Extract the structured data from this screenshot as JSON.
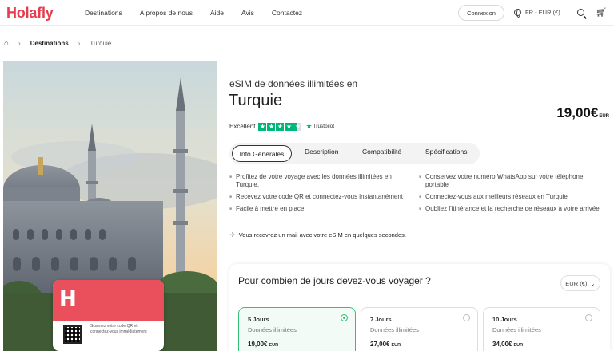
{
  "header": {
    "logo": "Holafly",
    "nav": [
      "Destinations",
      "A propos de nous",
      "Aide",
      "Avis",
      "Contactez"
    ],
    "login_label": "Connexion",
    "locale": "FR - EUR (€)"
  },
  "breadcrumb": {
    "destinations": "Destinations",
    "current": "Turquie"
  },
  "sim_card": {
    "logo": "H",
    "text": "Scannez votre code QR et connectez-vous immédiatement"
  },
  "product": {
    "subtitle": "eSIM de données illimitées en",
    "title": "Turquie",
    "price": "19,00€",
    "price_currency": "EUR",
    "rating_label": "Excellent",
    "trustpilot": "Trustpilot",
    "rating_stars": 4.5
  },
  "tabs": [
    {
      "label": "Info Générales",
      "active": true
    },
    {
      "label": "Description",
      "active": false
    },
    {
      "label": "Compatibilité",
      "active": false
    },
    {
      "label": "Spécifications",
      "active": false
    }
  ],
  "features_left": [
    "Profitez de votre voyage avec les données illimitées en Turquie.",
    "Recevez votre code QR et connectez-vous instantanément",
    "Facile à mettre en place"
  ],
  "features_right": [
    "Conservez votre numéro WhatsApp sur votre téléphone portable",
    "Connectez-vous aux meilleurs réseaux en Turquie",
    "Oubliez l'itinérance et la recherche de réseaux à votre arrivée"
  ],
  "notice": "Vous recevrez un mail avec votre eSIM en quelques secondes.",
  "days": {
    "question": "Pour combien de jours devez-vous voyager ?",
    "currency": "EUR (€)",
    "plans": [
      {
        "days": "5 Jours",
        "data": "Données illimitées",
        "price": "19,00€",
        "currency": "EUR",
        "selected": true
      },
      {
        "days": "7 Jours",
        "data": "Données illimitées",
        "price": "27,00€",
        "currency": "EUR",
        "selected": false
      },
      {
        "days": "10 Jours",
        "data": "Données illimitées",
        "price": "34,00€",
        "currency": "EUR",
        "selected": false
      }
    ]
  },
  "colors": {
    "brand": "#e63d4e",
    "trustpilot_green": "#00b67a",
    "selected_green": "#32c177"
  }
}
